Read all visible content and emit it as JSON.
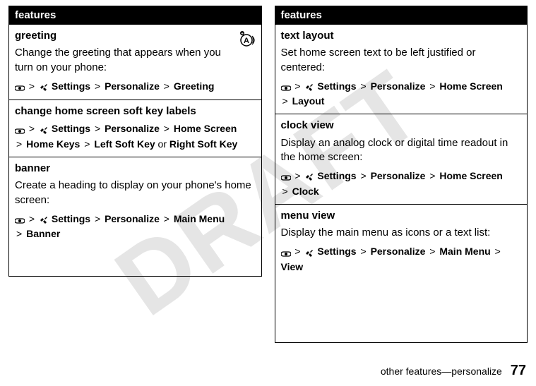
{
  "watermark": "DRAFT",
  "left": {
    "header": "features",
    "rows": [
      {
        "title": "greeting",
        "body": "Change the greeting that appears when you turn on your phone:",
        "path": {
          "s": "Settings",
          "p1": "Personalize",
          "p2": "Greeting"
        },
        "netIcon": true
      },
      {
        "title": "change home screen soft key labels",
        "body": "",
        "path5": {
          "s": "Settings",
          "p1": "Personalize",
          "p2": "Home Screen",
          "p3": "Home Keys",
          "p4": "Left Soft Key",
          "or": "or",
          "p5": "Right Soft Key"
        }
      },
      {
        "title": "banner",
        "body": "Create a heading to display on your phone's home screen:",
        "path3": {
          "s": "Settings",
          "p1": "Personalize",
          "p2": "Main Menu",
          "p3": "Banner"
        }
      }
    ]
  },
  "right": {
    "header": "features",
    "rows": [
      {
        "title": "text layout",
        "body": "Set home screen text to be left justified or centered:",
        "path3": {
          "s": "Settings",
          "p1": "Personalize",
          "p2": "Home Screen",
          "p3": "Layout"
        }
      },
      {
        "title": "clock view",
        "body": "Display an analog clock or digital time readout in the home screen:",
        "path3": {
          "s": "Settings",
          "p1": "Personalize",
          "p2": "Home Screen",
          "p3": "Clock"
        }
      },
      {
        "title": "menu view",
        "body": "Display the main menu as icons or a text list:",
        "path": {
          "s": "Settings",
          "p1": "Personalize",
          "p2": "Main Menu",
          "p2b": "View"
        }
      }
    ]
  },
  "footer": {
    "text": "other features—personalize",
    "page": "77"
  },
  "glyphs": {
    "gt": ">"
  }
}
